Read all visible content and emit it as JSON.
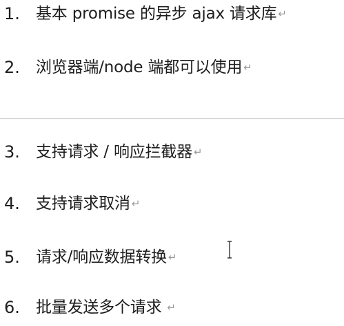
{
  "list": {
    "items": [
      {
        "number": "1.",
        "text": "基本 promise 的异步 ajax 请求库",
        "mark": "↵"
      },
      {
        "number": "2.",
        "text": "浏览器端/node 端都可以使用",
        "mark": "↵"
      },
      {
        "number": "3.",
        "text": "支持请求 / 响应拦截器",
        "mark": "↵"
      },
      {
        "number": "4.",
        "text": "支持请求取消",
        "mark": "↵"
      },
      {
        "number": "5.",
        "text": "请求/响应数据转换",
        "mark": "↵"
      },
      {
        "number": "6.",
        "text": "批量发送多个请求",
        "mark": "↵"
      }
    ]
  },
  "cursor": {
    "icon": "text-cursor-icon"
  }
}
